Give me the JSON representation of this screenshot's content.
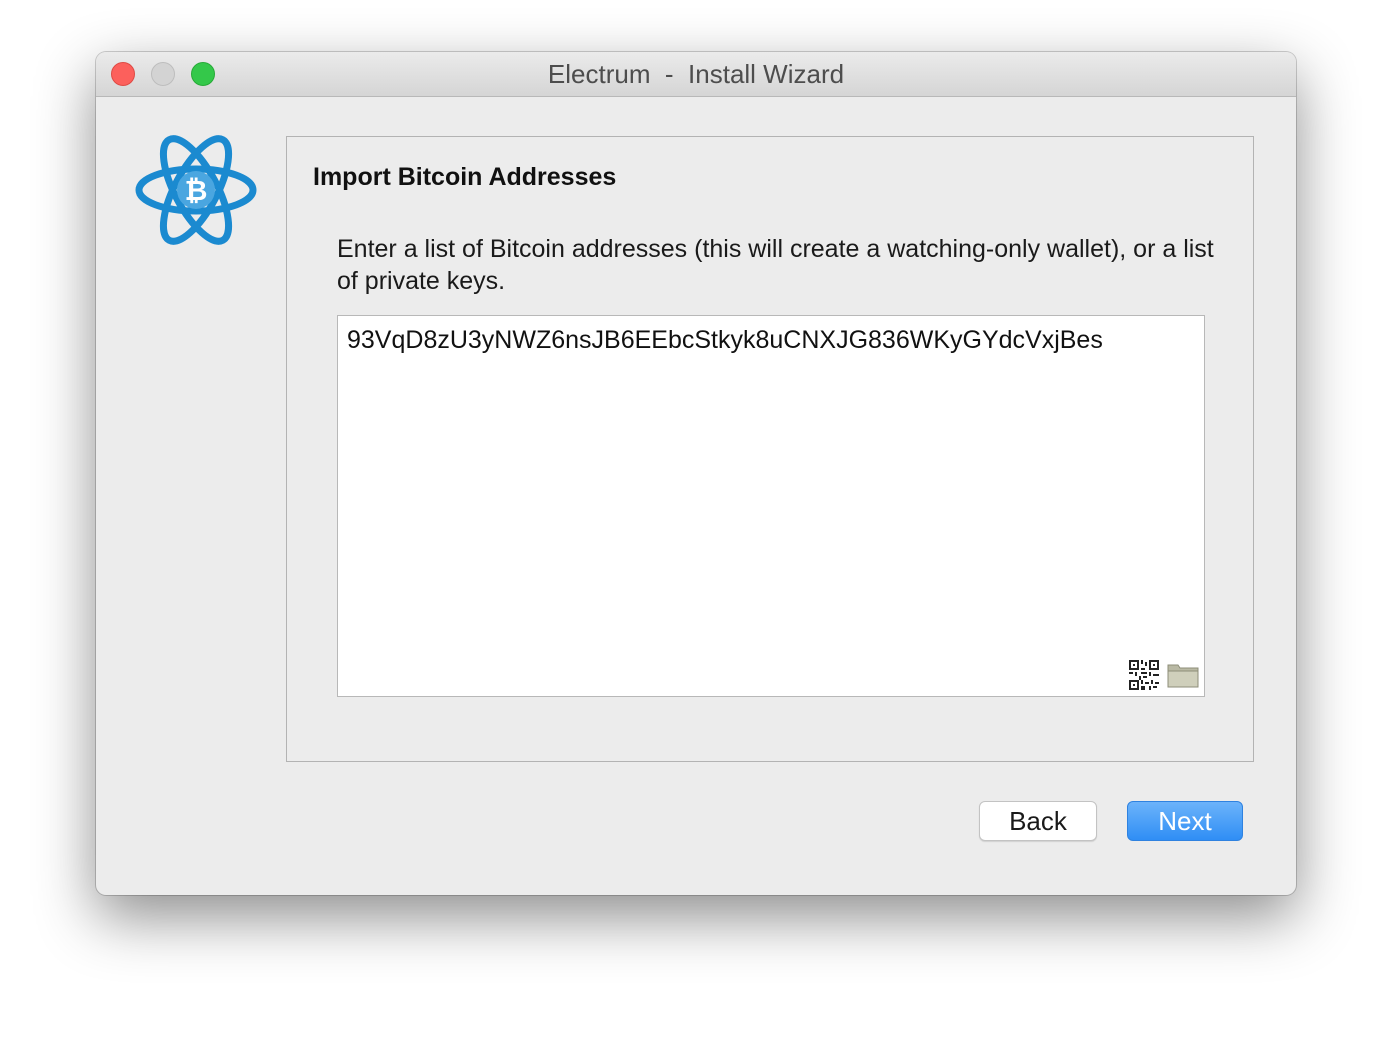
{
  "window": {
    "title": "Electrum  -  Install Wizard"
  },
  "logo": {
    "icon": "electrum-logo-icon",
    "color": "#1b8ad0"
  },
  "panel": {
    "title": "Import Bitcoin Addresses",
    "description": "Enter a list of Bitcoin addresses (this will create a watching-only wallet), or a list of private keys.",
    "input_value": "93VqD8zU3yNWZ6nsJB6EEbcStkyk8uCNXJG836WKyGYdcVxjBes",
    "icons": [
      "qr-code-icon",
      "folder-icon"
    ]
  },
  "buttons": {
    "back_label": "Back",
    "next_label": "Next"
  },
  "colors": {
    "accent": "#2f8ef5",
    "close": "#fc605c",
    "zoom": "#34c84a"
  }
}
